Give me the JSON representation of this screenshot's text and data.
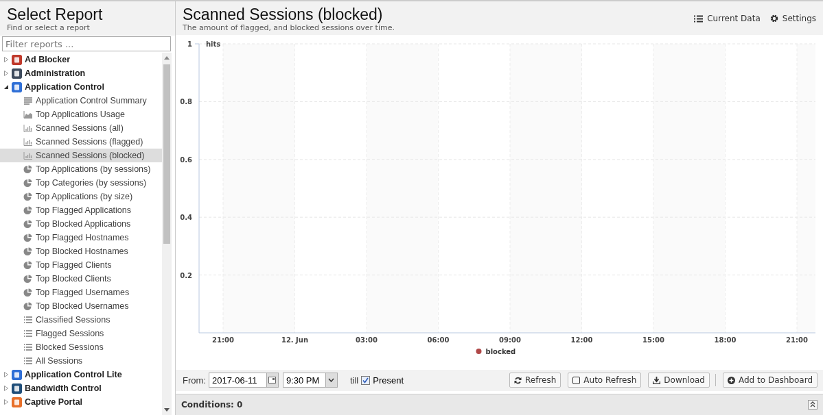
{
  "sidebar": {
    "title": "Select Report",
    "subtitle": "Find or select a report",
    "filter": {
      "placeholder": "Filter reports ..."
    },
    "tree": [
      {
        "label": "Ad Blocker",
        "color": "#c0392b",
        "expanded": false
      },
      {
        "label": "Administration",
        "color": "#3d4a5c",
        "expanded": false
      },
      {
        "label": "Application Control",
        "color": "#2f6fd6",
        "expanded": true,
        "children": [
          {
            "label": "Application Control Summary",
            "kind": "summary",
            "selected": false
          },
          {
            "label": "Top Applications Usage",
            "kind": "area",
            "selected": false
          },
          {
            "label": "Scanned Sessions (all)",
            "kind": "bar",
            "selected": false
          },
          {
            "label": "Scanned Sessions (flagged)",
            "kind": "bar",
            "selected": false
          },
          {
            "label": "Scanned Sessions (blocked)",
            "kind": "bar",
            "selected": true
          },
          {
            "label": "Top Applications (by sessions)",
            "kind": "pie",
            "selected": false
          },
          {
            "label": "Top Categories (by sessions)",
            "kind": "pie",
            "selected": false
          },
          {
            "label": "Top Applications (by size)",
            "kind": "pie",
            "selected": false
          },
          {
            "label": "Top Flagged Applications",
            "kind": "pie",
            "selected": false
          },
          {
            "label": "Top Blocked Applications",
            "kind": "pie",
            "selected": false
          },
          {
            "label": "Top Flagged Hostnames",
            "kind": "pie",
            "selected": false
          },
          {
            "label": "Top Blocked Hostnames",
            "kind": "pie",
            "selected": false
          },
          {
            "label": "Top Flagged Clients",
            "kind": "pie",
            "selected": false
          },
          {
            "label": "Top Blocked Clients",
            "kind": "pie",
            "selected": false
          },
          {
            "label": "Top Flagged Usernames",
            "kind": "pie",
            "selected": false
          },
          {
            "label": "Top Blocked Usernames",
            "kind": "pie",
            "selected": false
          },
          {
            "label": "Classified Sessions",
            "kind": "list",
            "selected": false
          },
          {
            "label": "Flagged Sessions",
            "kind": "list",
            "selected": false
          },
          {
            "label": "Blocked Sessions",
            "kind": "list",
            "selected": false
          },
          {
            "label": "All Sessions",
            "kind": "list",
            "selected": false
          }
        ]
      },
      {
        "label": "Application Control Lite",
        "color": "#2f6fd6",
        "expanded": false
      },
      {
        "label": "Bandwidth Control",
        "color": "#1f4e79",
        "expanded": false
      },
      {
        "label": "Captive Portal",
        "color": "#e8702a",
        "expanded": false
      }
    ]
  },
  "report": {
    "title": "Scanned Sessions (blocked)",
    "description": "The amount of flagged, and blocked sessions over time.",
    "actions": [
      {
        "label": "Current Data",
        "kind": "list"
      },
      {
        "label": "Settings",
        "kind": "gear"
      }
    ],
    "chart_data": {
      "type": "line",
      "ylabel": "hits",
      "categories": [
        "21:00",
        "12. Jun",
        "03:00",
        "06:00",
        "09:00",
        "12:00",
        "15:00",
        "18:00",
        "21:00"
      ],
      "series": [
        {
          "name": "blocked",
          "color": "#b04848",
          "values": [
            null,
            null,
            null,
            null,
            null,
            null,
            null,
            null,
            null
          ]
        }
      ],
      "ylim": [
        0,
        1
      ],
      "grid": true,
      "yticks": [
        0.2,
        0.4,
        0.6,
        0.8,
        1
      ]
    },
    "toolbar": {
      "from_label": "From:",
      "date": "2017-06-11",
      "time": "9:30 PM",
      "till_label": "till",
      "present": {
        "label": "Present",
        "checked": true
      },
      "buttons": [
        {
          "label": "Refresh",
          "kind": "refresh"
        },
        {
          "label": "Auto Refresh",
          "kind": "checkbox",
          "checked": false
        },
        {
          "label": "Download",
          "kind": "download"
        },
        {
          "label": "Add to Dashboard",
          "kind": "add"
        }
      ]
    },
    "conditions": "Conditions: 0"
  }
}
